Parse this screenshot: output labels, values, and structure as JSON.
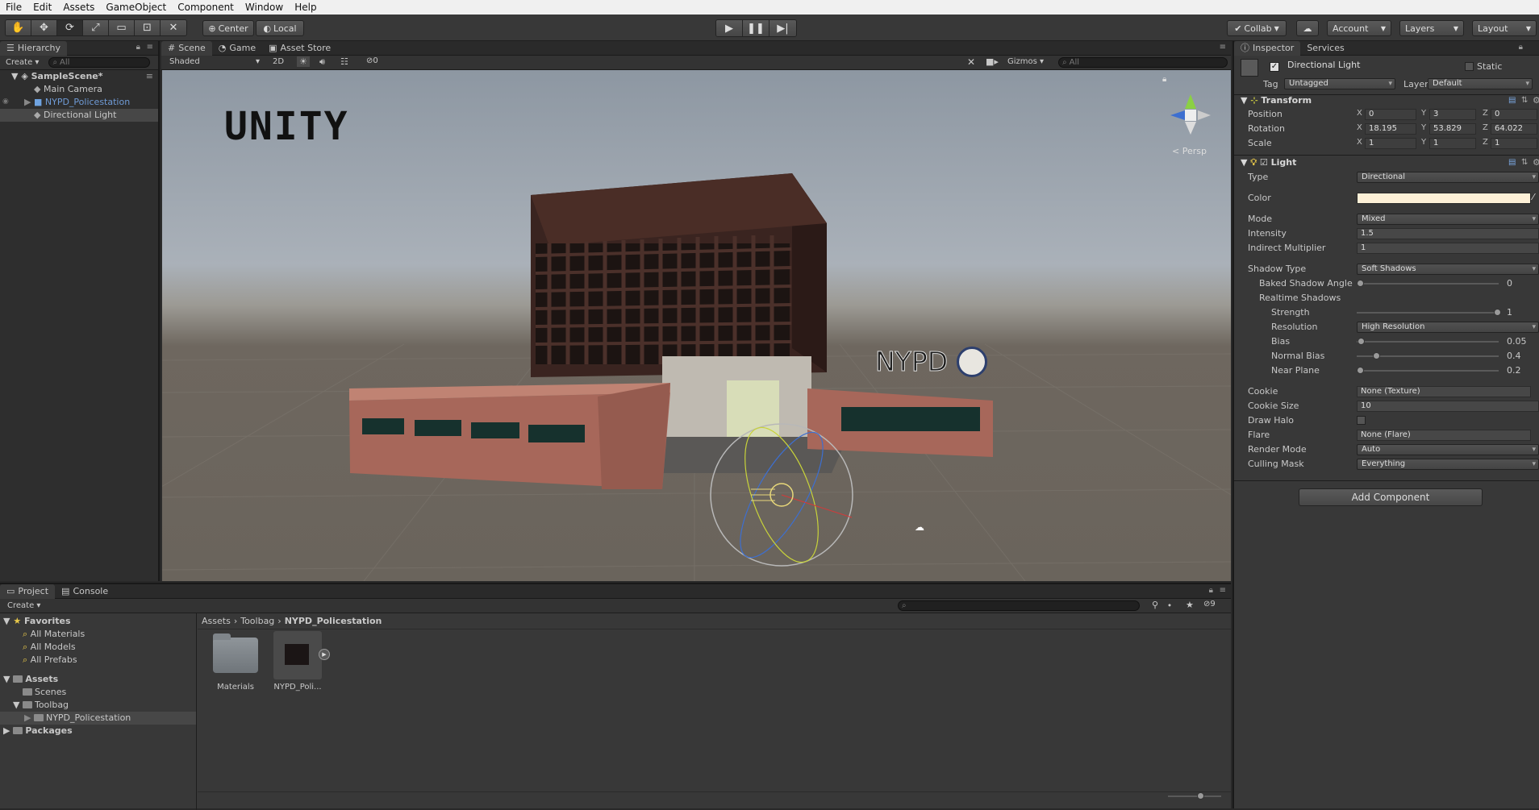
{
  "menu": [
    "File",
    "Edit",
    "Assets",
    "GameObject",
    "Component",
    "Window",
    "Help"
  ],
  "toolbar": {
    "pivot": "Center",
    "space": "Local",
    "collab": "Collab",
    "account": "Account",
    "layers": "Layers",
    "layout": "Layout"
  },
  "hierarchy": {
    "tab": "Hierarchy",
    "create": "Create",
    "search": "All",
    "scene": "SampleScene*",
    "items": [
      "Main Camera",
      "NYPD_Policestation",
      "Directional Light"
    ]
  },
  "scene": {
    "tabs": [
      "Scene",
      "Game",
      "Asset Store"
    ],
    "shading": "Shaded",
    "mode2d": "2D",
    "hidden_count": "0",
    "gizmos": "Gizmos",
    "search": "All",
    "persp": "Persp",
    "watermark": "UNITY",
    "sign": "NYPD"
  },
  "inspector": {
    "tabs": [
      "Inspector",
      "Services"
    ],
    "object_name": "Directional Light",
    "static": "Static",
    "tag_label": "Tag",
    "tag": "Untagged",
    "layer_label": "Layer",
    "layer": "Default",
    "transform": {
      "title": "Transform",
      "position": {
        "label": "Position",
        "x": "0",
        "y": "3",
        "z": "0"
      },
      "rotation": {
        "label": "Rotation",
        "x": "18.195",
        "y": "53.829",
        "z": "64.022"
      },
      "scale": {
        "label": "Scale",
        "x": "1",
        "y": "1",
        "z": "1"
      }
    },
    "light": {
      "title": "Light",
      "type_label": "Type",
      "type": "Directional",
      "color_label": "Color",
      "color": "#fdf0d7",
      "mode_label": "Mode",
      "mode": "Mixed",
      "intensity_label": "Intensity",
      "intensity": "1.5",
      "indirect_label": "Indirect Multiplier",
      "indirect": "1",
      "shadow_type_label": "Shadow Type",
      "shadow_type": "Soft Shadows",
      "baked_angle_label": "Baked Shadow Angle",
      "baked_angle": "0",
      "realtime_label": "Realtime Shadows",
      "strength_label": "Strength",
      "strength": "1",
      "resolution_label": "Resolution",
      "resolution": "High Resolution",
      "bias_label": "Bias",
      "bias": "0.05",
      "normal_bias_label": "Normal Bias",
      "normal_bias": "0.4",
      "near_plane_label": "Near Plane",
      "near_plane": "0.2",
      "cookie_label": "Cookie",
      "cookie": "None (Texture)",
      "cookie_size_label": "Cookie Size",
      "cookie_size": "10",
      "draw_halo_label": "Draw Halo",
      "flare_label": "Flare",
      "flare": "None (Flare)",
      "render_mode_label": "Render Mode",
      "render_mode": "Auto",
      "culling_label": "Culling Mask",
      "culling": "Everything"
    },
    "add_component": "Add Component"
  },
  "project": {
    "tabs": [
      "Project",
      "Console"
    ],
    "create": "Create",
    "hidden_count": "9",
    "favorites": "Favorites",
    "fav_items": [
      "All Materials",
      "All Models",
      "All Prefabs"
    ],
    "assets": "Assets",
    "asset_items": [
      "Scenes",
      "Toolbag",
      "NYPD_Policestation"
    ],
    "packages": "Packages",
    "breadcrumb": [
      "Assets",
      "Toolbag",
      "NYPD_Policestation"
    ],
    "files": [
      "Materials",
      "NYPD_Poli..."
    ]
  },
  "colors": {
    "accent": "#3d6fa5",
    "selected": "#474747",
    "sky": "#9aa3ad",
    "ground": "#6e675f"
  }
}
